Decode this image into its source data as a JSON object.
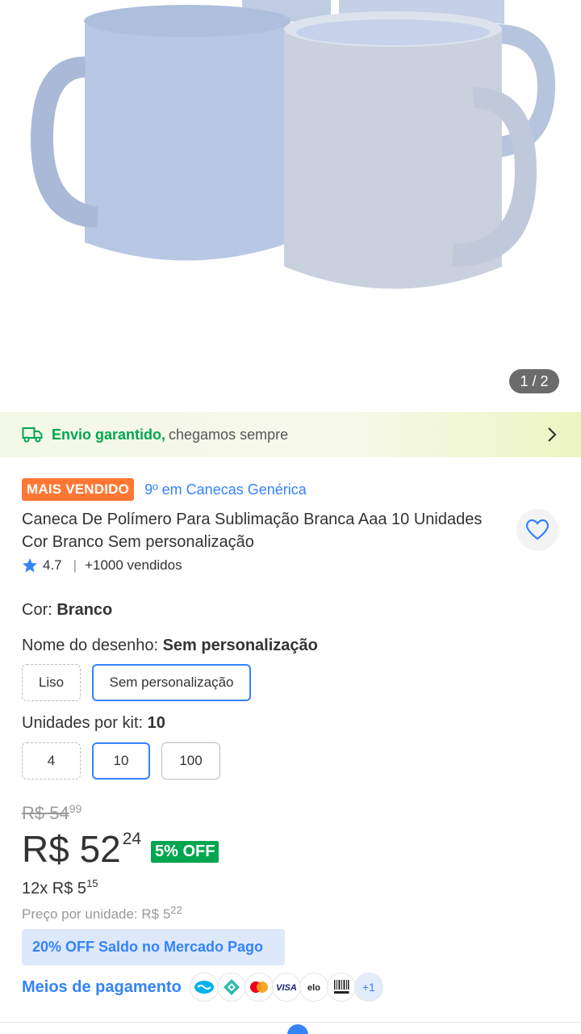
{
  "gallery": {
    "counter": "1 / 2",
    "image_alt": "caneca-mugs-photo"
  },
  "shipping": {
    "icon": "truck-icon",
    "strong": "Envio garantido,",
    "rest": "chegamos sempre"
  },
  "product": {
    "badge": "MAIS VENDIDO",
    "rank": "9º em Canecas Genérica",
    "title": "Caneca De Polímero Para Sublimação Branca Aaa 10 Unidades Cor Branco Sem personalização",
    "rating": "4.7",
    "sold": "+1000 vendidos"
  },
  "variations": {
    "color_label": "Cor:",
    "color_value": "Branco",
    "design_label": "Nome do desenho:",
    "design_value": "Sem personalização",
    "design_options": [
      "Liso",
      "Sem personalização"
    ],
    "units_label": "Unidades por kit:",
    "units_value": "10",
    "units_options": [
      "4",
      "10",
      "100"
    ]
  },
  "pricing": {
    "old_int": "R$ 54",
    "old_cents": "99",
    "int": "R$ 52",
    "cents": "24",
    "discount": "5% OFF",
    "installments_prefix": "12x R$ 5",
    "installments_cents": "15",
    "unit_prefix": "Preço por unidade: R$ 5",
    "unit_cents": "22",
    "promo": "20% OFF Saldo no Mercado Pago"
  },
  "payments": {
    "label": "Meios de pagamento",
    "more": "+1",
    "methods": [
      "mercado-pago",
      "pix",
      "mastercard",
      "visa",
      "elo",
      "boleto"
    ]
  },
  "colors": {
    "accent": "#3483fa",
    "green": "#00a650",
    "orange": "#ff7733"
  }
}
